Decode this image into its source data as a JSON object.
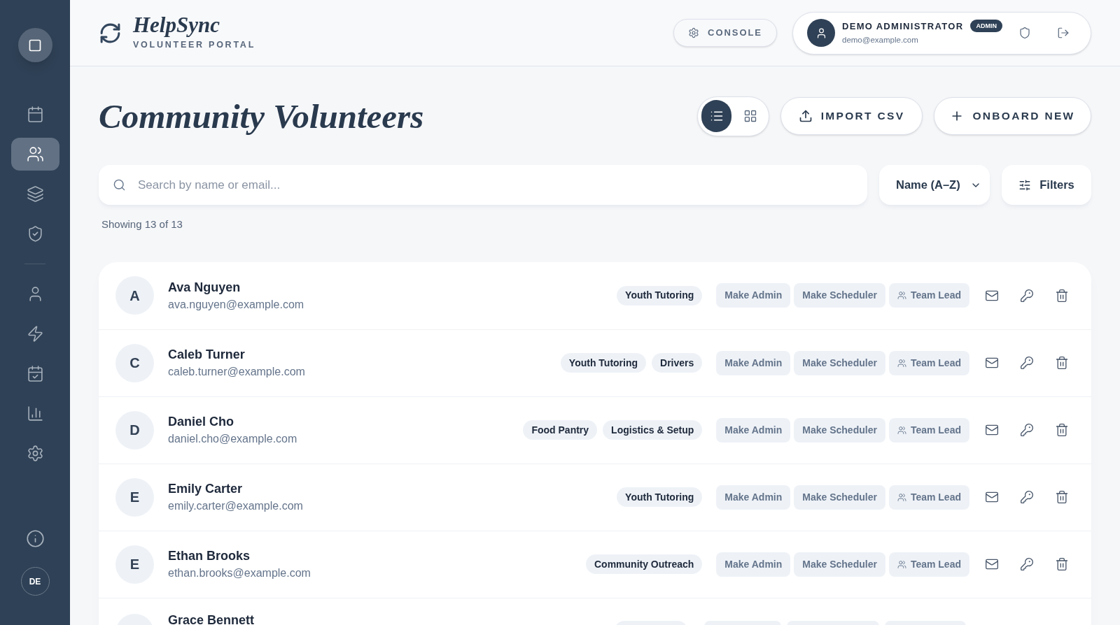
{
  "sidebar": {
    "items": [
      {
        "kind": "calendar",
        "selected": false
      },
      {
        "kind": "users",
        "selected": true
      },
      {
        "kind": "layers",
        "selected": false
      },
      {
        "kind": "shield",
        "selected": false
      },
      {
        "kind": "user",
        "selected": false
      },
      {
        "kind": "zap",
        "selected": false
      },
      {
        "kind": "schedule",
        "selected": false
      },
      {
        "kind": "chart",
        "selected": false
      },
      {
        "kind": "settings",
        "selected": false
      }
    ],
    "avatar": "DE"
  },
  "header": {
    "brand": "HelpSync",
    "subtitle": "VOLUNTEER PORTAL",
    "console": "CONSOLE",
    "user": {
      "name": "DEMO ADMINISTRATOR",
      "role": "ADMIN",
      "email": "demo@example.com"
    }
  },
  "page": {
    "title": "Community Volunteers",
    "view": [
      {
        "kind": "list",
        "selected": true
      },
      {
        "kind": "grid",
        "selected": false
      }
    ],
    "import": "IMPORT CSV",
    "onboard": "ONBOARD NEW"
  },
  "search": {
    "placeholder": "Search by name or email..."
  },
  "sort": "Name (A–Z)",
  "filters": "Filters",
  "count": "Showing 13 of 13",
  "volunteers": [
    {
      "kind": "full",
      "initial": "A",
      "name": "Ava Nguyen",
      "email": "ava.nguyen@example.com",
      "tags": [
        "Youth Tutoring"
      ],
      "actions": [
        {
          "label": "Make Admin",
          "kind": "plain"
        },
        {
          "label": "Make Scheduler",
          "kind": "plain"
        },
        {
          "label": "Team Lead",
          "kind": "team"
        }
      ]
    },
    {
      "kind": "full",
      "initial": "C",
      "name": "Caleb Turner",
      "email": "caleb.turner@example.com",
      "tags": [
        "Youth Tutoring",
        "Drivers"
      ],
      "actions": [
        {
          "label": "Make Admin",
          "kind": "plain"
        },
        {
          "label": "Make Scheduler",
          "kind": "plain"
        },
        {
          "label": "Team Lead",
          "kind": "team"
        }
      ]
    },
    {
      "kind": "full",
      "initial": "D",
      "name": "Daniel Cho",
      "email": "daniel.cho@example.com",
      "tags": [
        "Food Pantry",
        "Logistics & Setup"
      ],
      "actions": [
        {
          "label": "Make Admin",
          "kind": "plain"
        },
        {
          "label": "Make Scheduler",
          "kind": "plain"
        },
        {
          "label": "Team Lead",
          "kind": "team"
        }
      ]
    },
    {
      "kind": "full",
      "initial": "E",
      "name": "Emily Carter",
      "email": "emily.carter@example.com",
      "tags": [
        "Youth Tutoring"
      ],
      "actions": [
        {
          "label": "Make Admin",
          "kind": "plain"
        },
        {
          "label": "Make Scheduler",
          "kind": "plain"
        },
        {
          "label": "Team Lead",
          "kind": "team"
        }
      ]
    },
    {
      "kind": "full",
      "initial": "E",
      "name": "Ethan Brooks",
      "email": "ethan.brooks@example.com",
      "tags": [
        "Community Outreach"
      ],
      "actions": [
        {
          "label": "Make Admin",
          "kind": "plain"
        },
        {
          "label": "Make Scheduler",
          "kind": "plain"
        },
        {
          "label": "Team Lead",
          "kind": "team"
        }
      ]
    },
    {
      "kind": "partial",
      "name": "Grace Bennett"
    }
  ]
}
